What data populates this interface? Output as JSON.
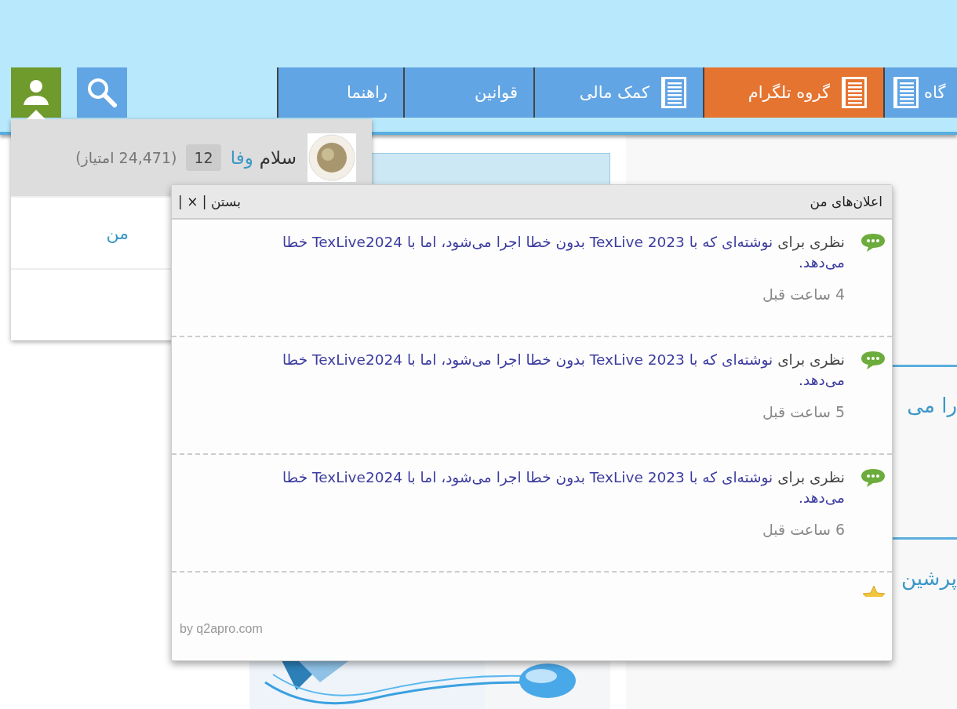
{
  "nav": {
    "tabs": [
      {
        "label": "گاه",
        "selected": false,
        "icon": true
      },
      {
        "label": "گروه تلگرام",
        "selected": true,
        "icon": true
      },
      {
        "label": "کمک مالی",
        "selected": false,
        "icon": true
      },
      {
        "label": "قوانین",
        "selected": false,
        "icon": false
      },
      {
        "label": "راهنما",
        "selected": false,
        "icon": false
      }
    ]
  },
  "content": {
    "sections": [
      {
        "text": "را می"
      },
      {
        "text": "پرشین"
      }
    ]
  },
  "user_menu": {
    "greeting": "سلام",
    "username": "وفا",
    "badge": "12",
    "points": "(24,471 امتیاز)",
    "link": "من"
  },
  "notifications": {
    "title": "اعلان‌های من",
    "close": "بستن | × |",
    "items": [
      {
        "kind": "comment",
        "prefix": "نظری برای",
        "link": "نوشته‌ای که با TexLive 2023 بدون خطا اجرا می‌شود، اما با TexLive2024 خطا می‌دهد.",
        "time": "4 ساعت قبل"
      },
      {
        "kind": "comment",
        "prefix": "نظری برای",
        "link": "نوشته‌ای که با TexLive 2023 بدون خطا اجرا می‌شود، اما با TexLive2024 خطا می‌دهد.",
        "time": "5 ساعت قبل"
      },
      {
        "kind": "comment",
        "prefix": "نظری برای",
        "link": "نوشته‌ای که با TexLive 2023 بدون خطا اجرا می‌شود، اما با TexLive2024 خطا می‌دهد.",
        "time": "6 ساعت قبل"
      },
      {
        "kind": "favorite"
      }
    ],
    "footer": "by q2apro.com"
  }
}
